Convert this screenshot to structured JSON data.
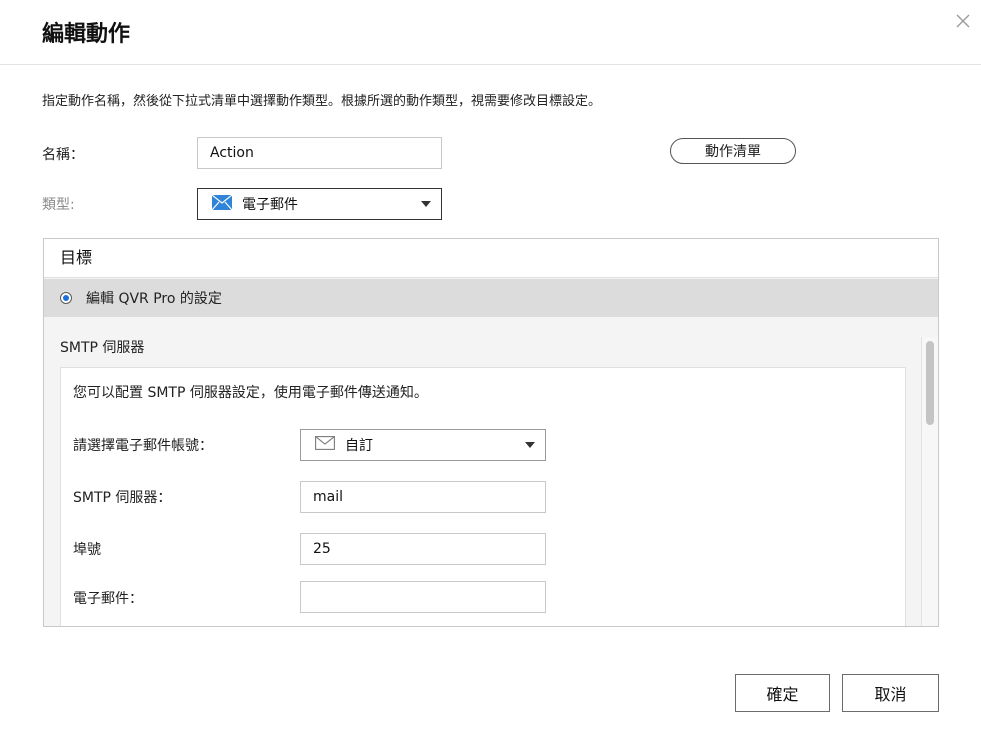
{
  "dialog": {
    "title": "編輯動作",
    "description": "指定動作名稱，然後從下拉式清單中選擇動作類型。根據所選的動作類型，視需要修改目標設定。"
  },
  "form": {
    "name_label": "名稱：",
    "name_value": "Action",
    "type_label": "類型:",
    "type_value": "電子郵件",
    "action_list_button": "動作清單"
  },
  "target": {
    "heading": "目標",
    "radio_label": "編輯 QVR Pro 的設定",
    "radio_selected": true,
    "section_title": "SMTP 伺服器",
    "intro": "您可以配置 SMTP 伺服器設定，使用電子郵件傳送通知。",
    "account_label": "請選擇電子郵件帳號：",
    "account_value": "自訂",
    "smtp_label": "SMTP 伺服器：",
    "smtp_value": "mail",
    "port_label": "埠號",
    "port_value": "25",
    "email_label": "電子郵件：",
    "email_value": ""
  },
  "footer": {
    "ok": "確定",
    "cancel": "取消"
  },
  "icons": {
    "close": "close-icon",
    "mail_blue": "mail-icon",
    "mail_outline": "mail-outline-icon",
    "caret": "chevron-down-icon"
  },
  "colors": {
    "accent": "#1d6fd8",
    "mail_icon": "#2f83d8",
    "selected_row": "#dcdcdc"
  }
}
